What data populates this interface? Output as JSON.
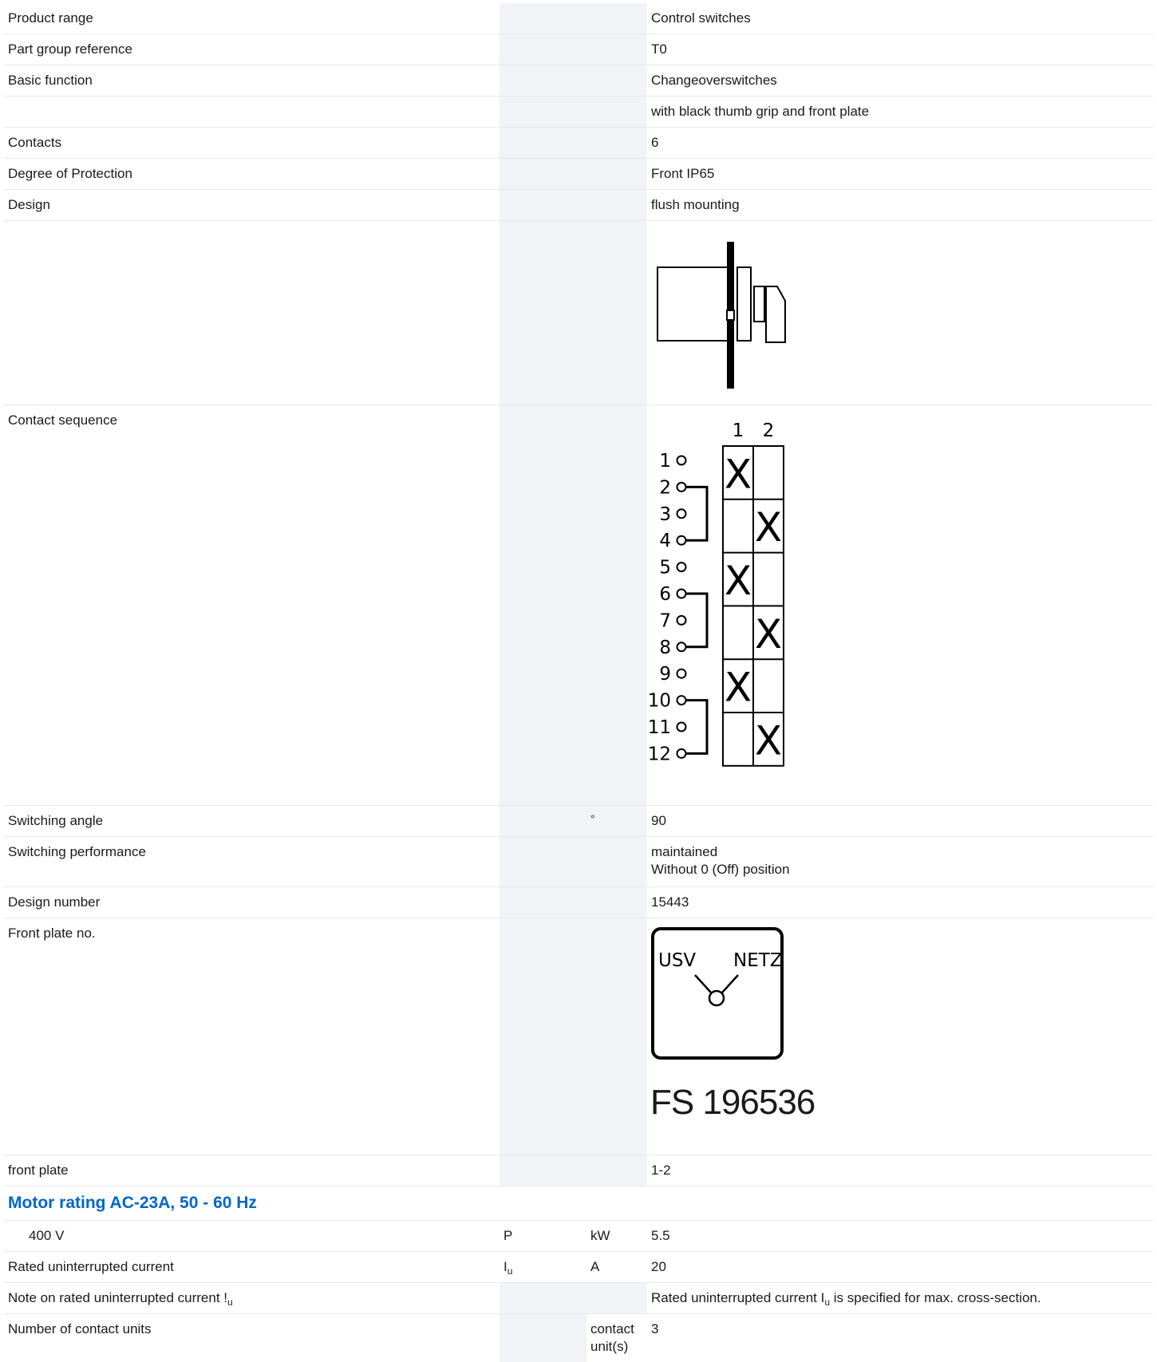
{
  "rows": {
    "product_range": {
      "label": "Product range",
      "value": "Control switches"
    },
    "part_group": {
      "label": "Part group reference",
      "value": "T0"
    },
    "basic_function": {
      "label": "Basic function",
      "value": "Changeoverswitches"
    },
    "basic_function_2": {
      "value": "with black thumb grip and front plate"
    },
    "contacts": {
      "label": "Contacts",
      "value": "6"
    },
    "protection": {
      "label": "Degree of Protection",
      "value": "Front IP65"
    },
    "design": {
      "label": "Design",
      "value": "flush mounting"
    },
    "contact_sequence": {
      "label": "Contact sequence",
      "positions": [
        "1",
        "2"
      ],
      "terminals": [
        "1",
        "2",
        "3",
        "4",
        "5",
        "6",
        "7",
        "8",
        "9",
        "10",
        "11",
        "12"
      ],
      "cross_mark": "X"
    },
    "switching_angle": {
      "label": "Switching angle",
      "unit": "°",
      "value": "90"
    },
    "switching_performance": {
      "label": "Switching performance",
      "value_1": "maintained",
      "value_2": "Without 0 (Off) position"
    },
    "design_number": {
      "label": "Design number",
      "value": "15443"
    },
    "front_plate_no": {
      "label": "Front plate no.",
      "left_text": "USV",
      "right_text": "NETZ",
      "code": "FS 196536"
    },
    "front_plate": {
      "label": "front plate",
      "value": "1-2"
    },
    "motor_rating": {
      "heading": "Motor rating AC-23A, 50 - 60 Hz"
    },
    "motor_400v": {
      "label": "400 V",
      "symbol": "P",
      "unit": "kW",
      "value": "5.5"
    },
    "rated_current": {
      "label": "Rated uninterrupted current",
      "symbol": "I",
      "symbol_sub": "u",
      "unit": "A",
      "value": "20"
    },
    "note_current": {
      "label": "Note on rated uninterrupted current !",
      "label_sub": "u",
      "value_pre": "Rated uninterrupted current I",
      "value_sub": "u",
      "value_post": " is specified for max. cross-section."
    },
    "contact_units": {
      "label": "Number of contact units",
      "unit_1": "contact",
      "unit_2": "unit(s)",
      "value": "3"
    }
  }
}
